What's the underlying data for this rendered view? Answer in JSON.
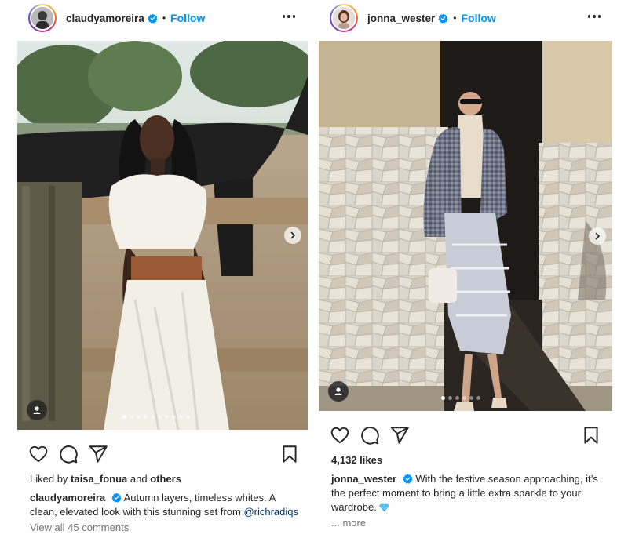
{
  "posts": [
    {
      "username": "claudyamoreira",
      "dot": "•",
      "follow_label": "Follow",
      "carousel": {
        "count": 10,
        "active": 0
      },
      "liked_by_prefix": "Liked by ",
      "liked_by_user": "taisa_fonua",
      "liked_by_and": " and ",
      "liked_by_others": "others",
      "caption_user": "claudyamoreira",
      "caption_text": " Autumn layers, timeless whites. A clean, elevated look with this stunning set from ",
      "caption_mention": "@richradiqs",
      "comments_link": "View all 45 comments"
    },
    {
      "username": "jonna_wester",
      "dot": "•",
      "follow_label": "Follow",
      "carousel": {
        "count": 6,
        "active": 0
      },
      "likes": "4,132 likes",
      "caption_user": "jonna_wester",
      "caption_text": " With the festive season approaching, it’s the perfect moment to bring a little extra sparkle to your wardrobe. ",
      "more_label": "... more"
    }
  ],
  "icons": [
    "verified-badge-icon",
    "more-options-icon",
    "heart-icon",
    "comment-icon",
    "share-icon",
    "bookmark-icon",
    "chevron-right-icon",
    "user-tag-icon",
    "gem-emoji-icon"
  ],
  "colors": {
    "follow": "#0095f6",
    "verified": "#0095f6",
    "text": "#262626",
    "muted": "#737373",
    "mention": "#00376b"
  }
}
